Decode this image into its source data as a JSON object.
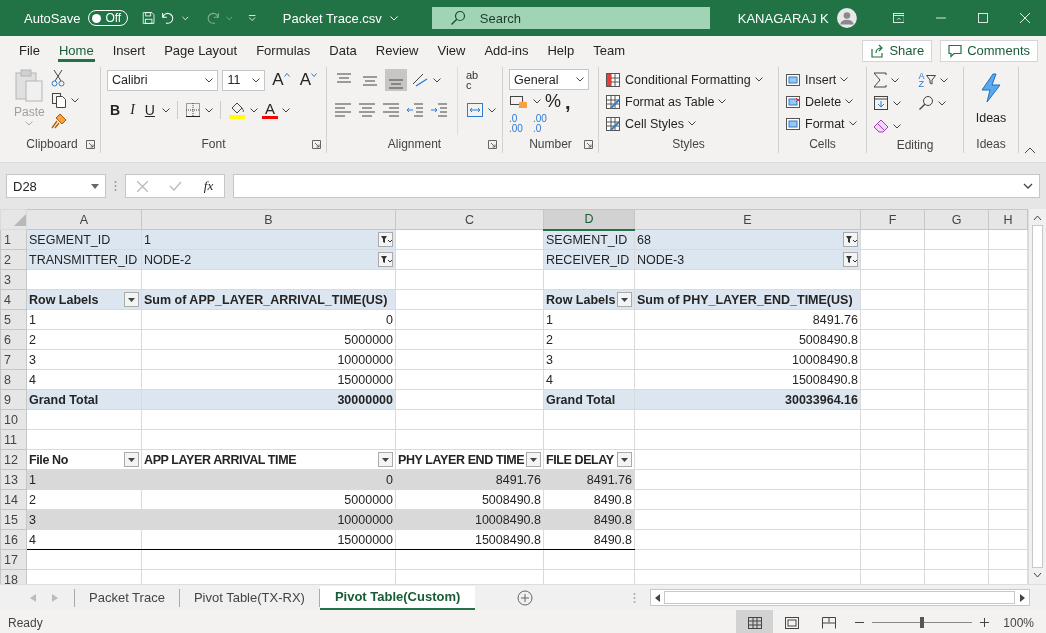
{
  "title_bar": {
    "autosave_label": "AutoSave",
    "autosave_on": false,
    "autosave_state": "Off",
    "filename": "Packet Trace.csv",
    "search_placeholder": "Search",
    "user": "KANAGARAJ K"
  },
  "ribbon_tabs": [
    {
      "label": "File",
      "selected": false
    },
    {
      "label": "Home",
      "selected": true
    },
    {
      "label": "Insert",
      "selected": false
    },
    {
      "label": "Page Layout",
      "selected": false
    },
    {
      "label": "Formulas",
      "selected": false
    },
    {
      "label": "Data",
      "selected": false
    },
    {
      "label": "Review",
      "selected": false
    },
    {
      "label": "View",
      "selected": false
    },
    {
      "label": "Add-ins",
      "selected": false
    },
    {
      "label": "Help",
      "selected": false
    },
    {
      "label": "Team",
      "selected": false
    }
  ],
  "share": "Share",
  "comments": "Comments",
  "ribbon": {
    "clipboard": {
      "title": "Clipboard",
      "paste": "Paste"
    },
    "font": {
      "title": "Font",
      "family": "Calibri",
      "size": "11",
      "grow": "A",
      "shrink": "A",
      "bold": "B",
      "italic": "I",
      "underline": "U",
      "font_color": "A"
    },
    "alignment": {
      "title": "Alignment",
      "wrap_top": "ab",
      "wrap_bottom": "c"
    },
    "number": {
      "title": "Number",
      "format": "General",
      "percent": "%",
      "comma": ",",
      "decimals": [
        {
          "top": ".0",
          "bottom": ".00"
        },
        {
          "top": ".00",
          "bottom": ".0"
        }
      ]
    },
    "styles": {
      "title": "Styles",
      "items": [
        "Conditional Formatting",
        "Format as Table",
        "Cell Styles"
      ]
    },
    "cells": {
      "title": "Cells",
      "items": [
        "Insert",
        "Delete",
        "Format"
      ]
    },
    "editing": {
      "title": "Editing",
      "sort_top": "A",
      "sort_bottom": "Z"
    },
    "ideas": {
      "title": "Ideas",
      "button": "Ideas"
    }
  },
  "formula_bar": {
    "name_box": "D28",
    "fx": "fx"
  },
  "grid": {
    "columns": [
      {
        "label": "A",
        "selected": false
      },
      {
        "label": "B",
        "selected": false
      },
      {
        "label": "C",
        "selected": false
      },
      {
        "label": "D",
        "selected": true
      },
      {
        "label": "E",
        "selected": false
      },
      {
        "label": "F",
        "selected": false
      },
      {
        "label": "G",
        "selected": false
      },
      {
        "label": "H",
        "selected": false
      }
    ],
    "rows": [
      {
        "number": "1",
        "banded": false,
        "rule_below": false,
        "cells": [
          {
            "kind": "field",
            "text": "SEGMENT_ID"
          },
          {
            "kind": "field",
            "text": "1",
            "button": {
              "kind": "filter"
            }
          },
          {
            "kind": "empty"
          },
          {
            "kind": "field",
            "text": "SEGMENT_ID"
          },
          {
            "kind": "field",
            "text": "68",
            "button": {
              "kind": "filter"
            }
          }
        ]
      },
      {
        "number": "2",
        "banded": false,
        "rule_below": false,
        "cells": [
          {
            "kind": "field",
            "text": "TRANSMITTER_ID"
          },
          {
            "kind": "field",
            "text": "NODE-2",
            "button": {
              "kind": "filter"
            }
          },
          {
            "kind": "empty"
          },
          {
            "kind": "field",
            "text": "RECEIVER_ID"
          },
          {
            "kind": "field",
            "text": "NODE-3",
            "button": {
              "kind": "filter"
            }
          }
        ]
      },
      {
        "number": "3",
        "banded": false,
        "rule_below": false
      },
      {
        "number": "4",
        "banded": false,
        "rule_below": false,
        "cells": [
          {
            "kind": "pivot-head",
            "text": "Row Labels",
            "button": {
              "kind": "dropdown"
            }
          },
          {
            "kind": "pivot-head",
            "text": "Sum of APP_LAYER_ARRIVAL_TIME(US)"
          },
          {
            "kind": "empty"
          },
          {
            "kind": "pivot-head",
            "text": "Row Labels",
            "button": {
              "kind": "dropdown"
            }
          },
          {
            "kind": "pivot-head",
            "text": "Sum of PHY_LAYER_END_TIME(US)"
          }
        ]
      },
      {
        "number": "5",
        "banded": false,
        "rule_below": false,
        "cells": [
          {
            "kind": "label",
            "text": "1"
          },
          {
            "kind": "number",
            "text": "0"
          },
          {
            "kind": "empty"
          },
          {
            "kind": "label",
            "text": "1"
          },
          {
            "kind": "number",
            "text": "8491.76"
          }
        ]
      },
      {
        "number": "6",
        "banded": false,
        "rule_below": false,
        "cells": [
          {
            "kind": "label",
            "text": "2"
          },
          {
            "kind": "number",
            "text": "5000000"
          },
          {
            "kind": "empty"
          },
          {
            "kind": "label",
            "text": "2"
          },
          {
            "kind": "number",
            "text": "5008490.8"
          }
        ]
      },
      {
        "number": "7",
        "banded": false,
        "rule_below": false,
        "cells": [
          {
            "kind": "label",
            "text": "3"
          },
          {
            "kind": "number",
            "text": "10000000"
          },
          {
            "kind": "empty"
          },
          {
            "kind": "label",
            "text": "3"
          },
          {
            "kind": "number",
            "text": "10008490.8"
          }
        ]
      },
      {
        "number": "8",
        "banded": false,
        "rule_below": false,
        "cells": [
          {
            "kind": "label",
            "text": "4"
          },
          {
            "kind": "number",
            "text": "15000000"
          },
          {
            "kind": "empty"
          },
          {
            "kind": "label",
            "text": "4"
          },
          {
            "kind": "number",
            "text": "15008490.8"
          }
        ]
      },
      {
        "number": "9",
        "banded": false,
        "rule_below": false,
        "cells": [
          {
            "kind": "total-label",
            "text": "Grand Total"
          },
          {
            "kind": "total-number",
            "text": "30000000"
          },
          {
            "kind": "empty"
          },
          {
            "kind": "total-label",
            "text": "Grand Total"
          },
          {
            "kind": "total-number",
            "text": "30033964.16"
          }
        ]
      },
      {
        "number": "10",
        "banded": false,
        "rule_below": false
      },
      {
        "number": "11",
        "banded": false,
        "rule_below": false
      },
      {
        "number": "12",
        "banded": false,
        "rule_below": false,
        "cells": [
          {
            "kind": "table-head",
            "text": "File No",
            "button": {
              "kind": "dropdown"
            }
          },
          {
            "kind": "table-head",
            "text": "APP LAYER ARRIVAL TIME",
            "button": {
              "kind": "dropdown"
            }
          },
          {
            "kind": "table-head",
            "text": "PHY LAYER END TIME",
            "button": {
              "kind": "dropdown"
            }
          },
          {
            "kind": "table-head",
            "text": "FILE DELAY",
            "button": {
              "kind": "dropdown"
            }
          }
        ]
      },
      {
        "number": "13",
        "banded": true,
        "rule_below": false,
        "cells": [
          {
            "kind": "label",
            "text": "1"
          },
          {
            "kind": "number",
            "text": "0"
          },
          {
            "kind": "number",
            "text": "8491.76"
          },
          {
            "kind": "number",
            "text": "8491.76"
          }
        ]
      },
      {
        "number": "14",
        "banded": false,
        "rule_below": false,
        "cells": [
          {
            "kind": "label",
            "text": "2"
          },
          {
            "kind": "number",
            "text": "5000000"
          },
          {
            "kind": "number",
            "text": "5008490.8"
          },
          {
            "kind": "number",
            "text": "8490.8"
          }
        ]
      },
      {
        "number": "15",
        "banded": true,
        "rule_below": false,
        "cells": [
          {
            "kind": "label",
            "text": "3"
          },
          {
            "kind": "number",
            "text": "10000000"
          },
          {
            "kind": "number",
            "text": "10008490.8"
          },
          {
            "kind": "number",
            "text": "8490.8"
          }
        ]
      },
      {
        "number": "16",
        "banded": false,
        "rule_below": true,
        "cells": [
          {
            "kind": "label",
            "text": "4"
          },
          {
            "kind": "number",
            "text": "15000000"
          },
          {
            "kind": "number",
            "text": "15008490.8"
          },
          {
            "kind": "number",
            "text": "8490.8"
          }
        ]
      },
      {
        "number": "17",
        "banded": false,
        "rule_below": false
      },
      {
        "number": "18",
        "banded": false,
        "rule_below": false
      }
    ]
  },
  "sheet_tabs": [
    {
      "label": "Packet Trace",
      "selected": false
    },
    {
      "label": "Pivot Table(TX-RX)",
      "selected": false
    },
    {
      "label": "Pivot Table(Custom)",
      "selected": true
    }
  ],
  "status_bar": {
    "status": "Ready",
    "views": [
      {
        "kind": "normal",
        "selected": true
      },
      {
        "kind": "page-layout",
        "selected": false
      },
      {
        "kind": "page-break",
        "selected": false
      }
    ],
    "level": 0.5,
    "zoom": "100%"
  }
}
